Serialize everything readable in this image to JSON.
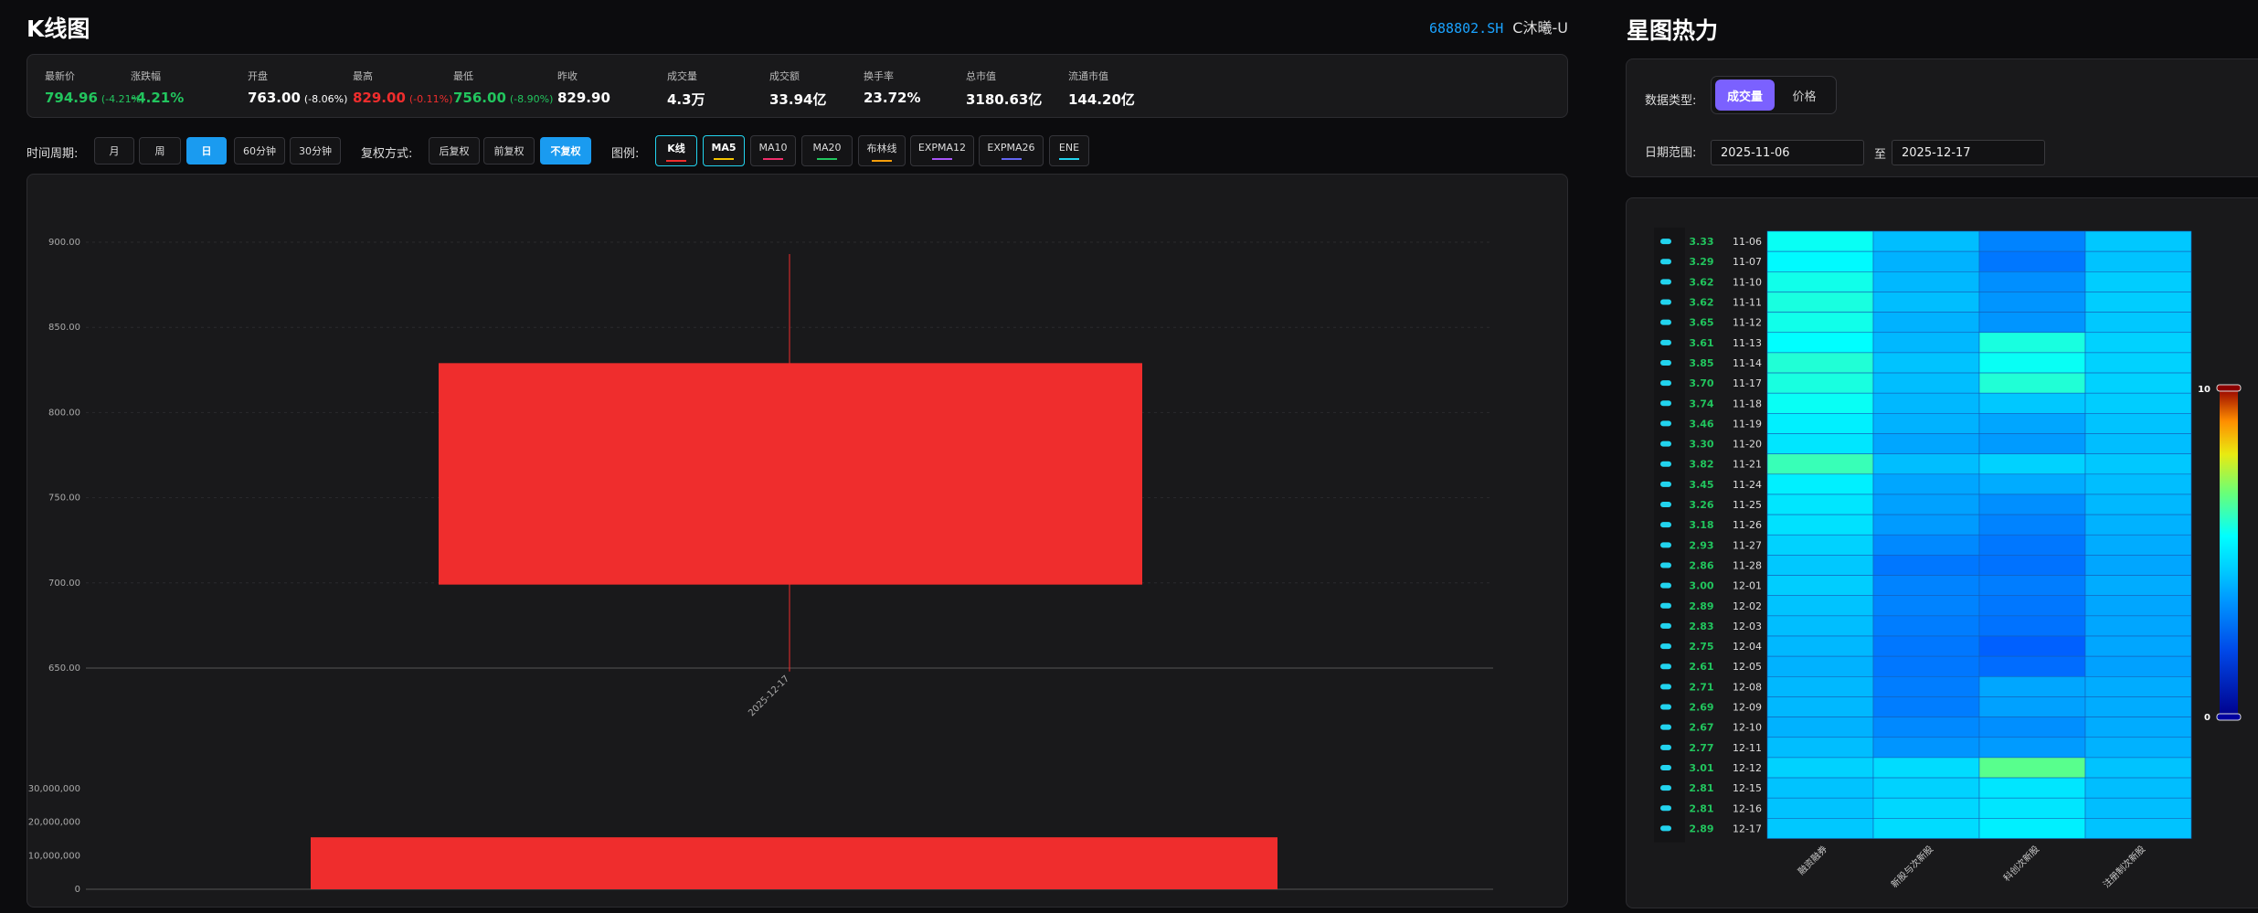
{
  "left": {
    "title": "K线图",
    "stock_code": "688802.SH",
    "stock_name": "C沐曦-U"
  },
  "stats": [
    {
      "label": "最新价",
      "value": "794.96",
      "change": "(-4.21%)",
      "color": "green"
    },
    {
      "label": "涨跌幅",
      "value": "-4.21%",
      "change": "",
      "color": "green"
    },
    {
      "label": "开盘",
      "value": "763.00",
      "change": "(-8.06%)",
      "color": "white"
    },
    {
      "label": "最高",
      "value": "829.00",
      "change": "(-0.11%)",
      "color": "red"
    },
    {
      "label": "最低",
      "value": "756.00",
      "change": "(-8.90%)",
      "color": "green"
    },
    {
      "label": "昨收",
      "value": "829.90",
      "change": "",
      "color": "white"
    },
    {
      "label": "成交量",
      "value": "4.3万",
      "change": "",
      "color": "white"
    },
    {
      "label": "成交额",
      "value": "33.94亿",
      "change": "",
      "color": "white"
    },
    {
      "label": "换手率",
      "value": "23.72%",
      "change": "",
      "color": "white"
    },
    {
      "label": "总市值",
      "value": "3180.63亿",
      "change": "",
      "color": "white"
    },
    {
      "label": "流通市值",
      "value": "144.20亿",
      "change": "",
      "color": "white"
    }
  ],
  "controls": {
    "period_label": "时间周期:",
    "periods": [
      "月",
      "周",
      "日",
      "60分钟",
      "30分钟"
    ],
    "period_active": 2,
    "adjust_label": "复权方式:",
    "adjusts": [
      "后复权",
      "前复权",
      "不复权"
    ],
    "adjust_active": 2,
    "legend_label": "图例:",
    "legends": [
      {
        "name": "K线",
        "color": "#ef2d2d",
        "on": true
      },
      {
        "name": "MA5",
        "color": "#f5c400",
        "on": true
      },
      {
        "name": "MA10",
        "color": "#ef2d6a",
        "on": false
      },
      {
        "name": "MA20",
        "color": "#22c55e",
        "on": false
      },
      {
        "name": "布林线",
        "color": "#f59e0b",
        "on": false
      },
      {
        "name": "EXPMA12",
        "color": "#a855f7",
        "on": false
      },
      {
        "name": "EXPMA26",
        "color": "#6366f1",
        "on": false
      },
      {
        "name": "ENE",
        "color": "#22d3ee",
        "on": false
      }
    ]
  },
  "chart_data": [
    {
      "type": "candlestick",
      "categories": [
        "2025-12-17"
      ],
      "open": [
        763.0
      ],
      "close": [
        794.96
      ],
      "high": [
        893.0
      ],
      "low": [
        648.0
      ],
      "box_top": 829.0,
      "box_bottom": 699.0,
      "yticks": [
        "900.00",
        "850.00",
        "800.00",
        "750.00",
        "700.00",
        "650.00"
      ],
      "ylim": [
        650,
        900
      ],
      "color": "#ef2d2d",
      "grid": true
    },
    {
      "type": "bar",
      "categories": [
        "2025-12-17"
      ],
      "values": [
        15500000
      ],
      "yticks": [
        "30,000,000",
        "20,000,000",
        "10,000,000",
        "0"
      ],
      "ylim": [
        0,
        30000000
      ],
      "color": "#ef2d2d"
    },
    {
      "type": "heatmap",
      "rows": [
        "11-06",
        "11-07",
        "11-10",
        "11-11",
        "11-12",
        "11-13",
        "11-14",
        "11-17",
        "11-18",
        "11-19",
        "11-20",
        "11-21",
        "11-24",
        "11-25",
        "11-26",
        "11-27",
        "11-28",
        "12-01",
        "12-02",
        "12-03",
        "12-04",
        "12-05",
        "12-08",
        "12-09",
        "12-10",
        "12-11",
        "12-12",
        "12-15",
        "12-16",
        "12-17"
      ],
      "row_values": [
        "3.33",
        "3.29",
        "3.62",
        "3.62",
        "3.65",
        "3.61",
        "3.85",
        "3.70",
        "3.74",
        "3.46",
        "3.30",
        "3.82",
        "3.45",
        "3.26",
        "3.18",
        "2.93",
        "2.86",
        "3.00",
        "2.89",
        "2.83",
        "2.75",
        "2.61",
        "2.71",
        "2.69",
        "2.67",
        "2.77",
        "3.01",
        "2.81",
        "2.81",
        "2.89"
      ],
      "columns": [
        "融资融券",
        "新股与次新股",
        "科创次新股",
        "注册制次新股"
      ],
      "cells": [
        [
          5.6,
          4.2,
          3.2,
          4.4
        ],
        [
          5.4,
          4.0,
          3.0,
          4.3
        ],
        [
          5.7,
          4.1,
          3.4,
          4.5
        ],
        [
          5.8,
          4.2,
          3.5,
          4.5
        ],
        [
          5.7,
          4.0,
          3.5,
          4.4
        ],
        [
          5.5,
          4.1,
          5.8,
          4.6
        ],
        [
          5.9,
          4.3,
          5.6,
          4.6
        ],
        [
          5.8,
          4.2,
          5.9,
          4.6
        ],
        [
          5.6,
          4.1,
          4.4,
          4.5
        ],
        [
          5.2,
          4.0,
          3.8,
          4.3
        ],
        [
          5.0,
          3.8,
          3.6,
          4.2
        ],
        [
          6.2,
          4.2,
          4.6,
          4.4
        ],
        [
          5.2,
          3.8,
          3.9,
          4.2
        ],
        [
          5.0,
          3.7,
          3.4,
          4.1
        ],
        [
          4.9,
          3.6,
          3.2,
          4.0
        ],
        [
          4.6,
          3.3,
          3.0,
          3.9
        ],
        [
          4.4,
          3.0,
          2.9,
          3.8
        ],
        [
          4.5,
          3.2,
          3.1,
          3.9
        ],
        [
          4.3,
          3.2,
          3.0,
          3.8
        ],
        [
          4.2,
          3.1,
          2.9,
          3.8
        ],
        [
          4.1,
          3.0,
          2.6,
          3.8
        ],
        [
          4.0,
          3.0,
          2.8,
          3.7
        ],
        [
          4.1,
          3.1,
          3.8,
          3.9
        ],
        [
          4.1,
          3.1,
          3.7,
          3.9
        ],
        [
          4.0,
          3.3,
          3.4,
          3.9
        ],
        [
          4.2,
          3.5,
          3.6,
          4.0
        ],
        [
          4.6,
          4.8,
          6.6,
          4.3
        ],
        [
          4.3,
          4.6,
          5.0,
          4.2
        ],
        [
          4.3,
          4.7,
          5.0,
          4.2
        ],
        [
          4.4,
          4.8,
          5.2,
          4.3
        ]
      ],
      "scale": {
        "min": 0,
        "max": 10,
        "min_label": "0",
        "max_label": "10"
      }
    }
  ],
  "right": {
    "title": "星图热力",
    "data_type_label": "数据类型:",
    "data_types": [
      "成交量",
      "价格"
    ],
    "data_type_active": 0,
    "date_range_label": "日期范围:",
    "date_from": "2025-11-06",
    "date_sep": "至",
    "date_to": "2025-12-17"
  },
  "colors": {
    "accent": "#1a9bf0",
    "purple": "#7b61ff",
    "up": "#ef2d2d",
    "down": "#22c55e"
  }
}
